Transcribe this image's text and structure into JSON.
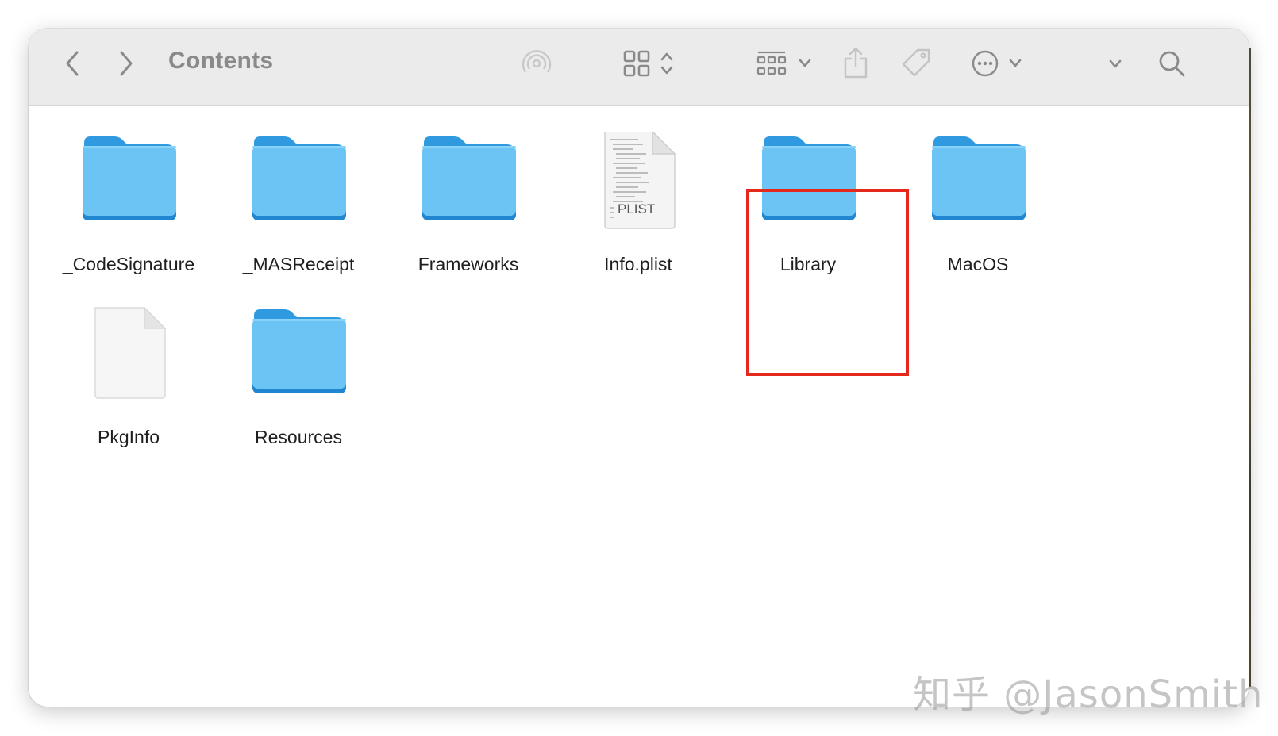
{
  "window": {
    "title": "Contents"
  },
  "toolbar": {
    "icons": [
      "back-icon",
      "forward-icon",
      "airdrop-icon",
      "grid-view-icon",
      "group-icon",
      "share-icon",
      "tag-icon",
      "more-icon",
      "expand-icon",
      "search-icon"
    ]
  },
  "files": [
    {
      "name": "_CodeSignature",
      "type": "folder"
    },
    {
      "name": "_MASReceipt",
      "type": "folder"
    },
    {
      "name": "Frameworks",
      "type": "folder"
    },
    {
      "name": "Info.plist",
      "type": "plist",
      "badge": "PLIST"
    },
    {
      "name": "Library",
      "type": "folder",
      "highlighted": true
    },
    {
      "name": "MacOS",
      "type": "folder"
    },
    {
      "name": "PkgInfo",
      "type": "document"
    },
    {
      "name": "Resources",
      "type": "folder"
    }
  ],
  "highlight_color": "#e5281c",
  "folder_color": "#6cc4f5",
  "watermark": "知乎 @JasonSmith"
}
